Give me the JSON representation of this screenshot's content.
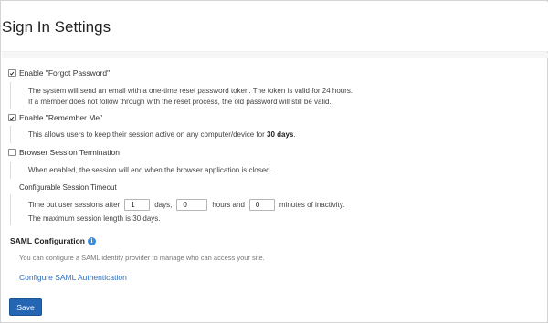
{
  "page": {
    "title": "Sign In Settings"
  },
  "forgot_password": {
    "label": "Enable \"Forgot Password\"",
    "checked": true,
    "desc_line1": "The system will send an email with a one-time reset password token. The token is valid for 24 hours.",
    "desc_line2": "If a member does not follow through with the reset process, the old password will still be valid."
  },
  "remember_me": {
    "label": "Enable \"Remember Me\"",
    "checked": true,
    "desc_prefix": "This allows users to keep their session active on any computer/device for ",
    "desc_bold": "30 days",
    "desc_suffix": "."
  },
  "browser_session": {
    "label": "Browser Session Termination",
    "checked": false,
    "desc": "When enabled, the session will end when the browser application is closed."
  },
  "session_timeout": {
    "label": "Configurable Session Timeout",
    "text_prefix": "Time out user sessions after",
    "days_value": "1",
    "days_label": "days,",
    "hours_value": "0",
    "hours_label": "hours and",
    "minutes_value": "0",
    "minutes_label": "minutes of inactivity.",
    "max_length": "The maximum session length is 30 days."
  },
  "saml": {
    "title": "SAML Configuration",
    "info_glyph": "i",
    "desc": "You can configure a SAML identity provider to manage who can access your site.",
    "link": "Configure SAML Authentication"
  },
  "actions": {
    "save_label": "Save"
  },
  "colors": {
    "accent": "#2466b4",
    "link": "#2a6ebd",
    "info": "#3c8dde"
  }
}
